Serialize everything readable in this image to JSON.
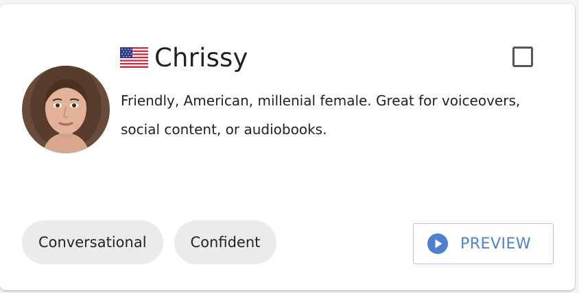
{
  "voice": {
    "name": "Chrissy",
    "flag_icon": "us-flag-icon",
    "description": "Friendly, American, millenial female. Great for voiceovers, social content, or audiobooks.",
    "selected": false
  },
  "tags": [
    "Conversational",
    "Confident"
  ],
  "preview": {
    "label": "PREVIEW",
    "icon": "play-circle-icon"
  },
  "colors": {
    "accent": "#4f7fd0",
    "tag_background": "#ebebeb",
    "preview_border": "#a9c2e6",
    "checkbox_border": "#555555"
  }
}
